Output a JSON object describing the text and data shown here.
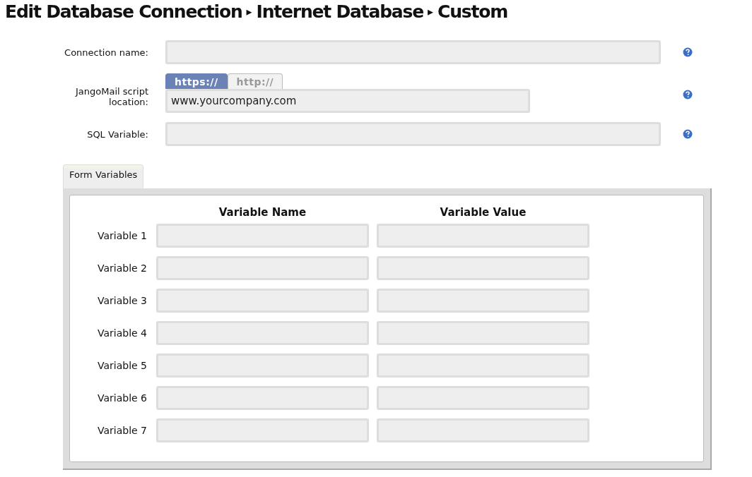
{
  "title": {
    "parts": [
      "Edit Database Connection",
      "Internet Database",
      "Custom"
    ],
    "separator": "▸"
  },
  "fields": [
    {
      "kind": "text",
      "label": "Connection name:"
    },
    {
      "kind": "protocol",
      "label": "JangoMail script location:",
      "value": "www.yourcompany.com",
      "tabs": [
        {
          "label": "https://",
          "selected": true
        },
        {
          "label": "http://",
          "selected": false
        }
      ]
    },
    {
      "kind": "text",
      "label": "SQL Variable:"
    }
  ],
  "form_tab": {
    "label": "Form Variables",
    "selected": true
  },
  "variables": {
    "columns": [
      "Variable Name",
      "Variable Value"
    ],
    "rows": [
      {
        "label": "Variable 1"
      },
      {
        "label": "Variable 2"
      },
      {
        "label": "Variable 3"
      },
      {
        "label": "Variable 4"
      },
      {
        "label": "Variable 5"
      },
      {
        "label": "Variable 6"
      },
      {
        "label": "Variable 7"
      }
    ]
  }
}
